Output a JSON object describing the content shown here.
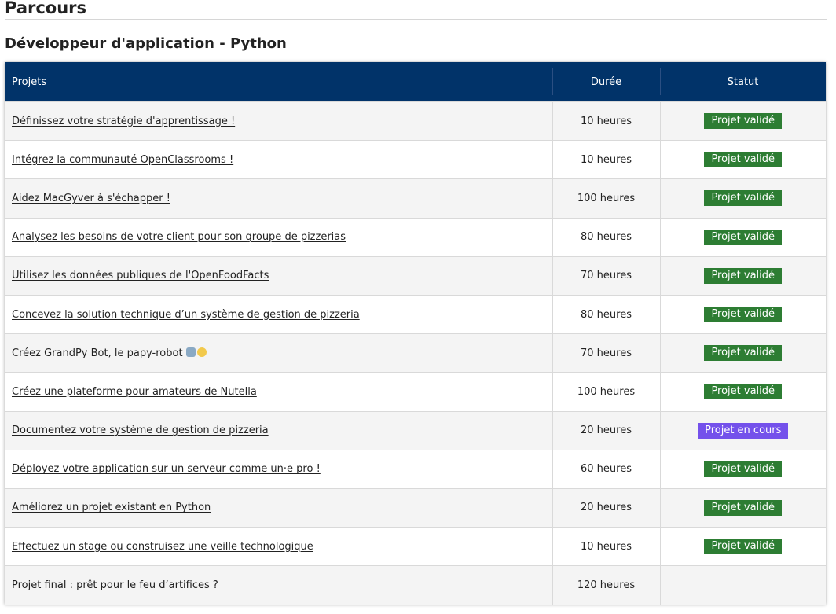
{
  "page": {
    "title": "Parcours"
  },
  "path": {
    "title": "Développeur d'application - Python"
  },
  "table": {
    "headers": {
      "project": "Projets",
      "duration": "Durée",
      "status": "Statut"
    },
    "rows": [
      {
        "project": "Définissez votre stratégie d'apprentissage !",
        "duration": "10 heures",
        "status": "Projet validé",
        "status_type": "validated"
      },
      {
        "project": "Intégrez la communauté OpenClassrooms !",
        "duration": "10 heures",
        "status": "Projet validé",
        "status_type": "validated"
      },
      {
        "project": "Aidez MacGyver à s'échapper !",
        "duration": "100 heures",
        "status": "Projet validé",
        "status_type": "validated"
      },
      {
        "project": "Analysez les besoins de votre client pour son groupe de pizzerias",
        "duration": "80 heures",
        "status": "Projet validé",
        "status_type": "validated"
      },
      {
        "project": "Utilisez les données publiques de l'OpenFoodFacts",
        "duration": "70 heures",
        "status": "Projet validé",
        "status_type": "validated"
      },
      {
        "project": "Concevez la solution technique d’un système de gestion de pizzeria",
        "duration": "80 heures",
        "status": "Projet validé",
        "status_type": "validated"
      },
      {
        "project": "Créez GrandPy Bot, le papy-robot",
        "duration": "70 heures",
        "status": "Projet validé",
        "status_type": "validated",
        "emoji_icons": [
          "robot-emoji-icon",
          "old-man-emoji-icon"
        ]
      },
      {
        "project": "Créez une plateforme pour amateurs de Nutella",
        "duration": "100 heures",
        "status": "Projet validé",
        "status_type": "validated"
      },
      {
        "project": "Documentez votre système de gestion de pizzeria",
        "duration": "20 heures",
        "status": "Projet en cours",
        "status_type": "inprogress"
      },
      {
        "project": "Déployez votre application sur un serveur comme un·e pro !",
        "duration": "60 heures",
        "status": "Projet validé",
        "status_type": "validated"
      },
      {
        "project": "Améliorez un projet existant en Python",
        "duration": "20 heures",
        "status": "Projet validé",
        "status_type": "validated"
      },
      {
        "project": "Effectuez un stage ou construisez une veille technologique",
        "duration": "10 heures",
        "status": "Projet validé",
        "status_type": "validated"
      },
      {
        "project": "Projet final : prêt pour le feu d’artifices ?",
        "duration": "120 heures",
        "status": "",
        "status_type": "none"
      }
    ]
  },
  "colors": {
    "header_bg": "#013369",
    "validated": "#2d7d33",
    "in_progress": "#7451eb",
    "row_alt": "#f4f4f4"
  }
}
